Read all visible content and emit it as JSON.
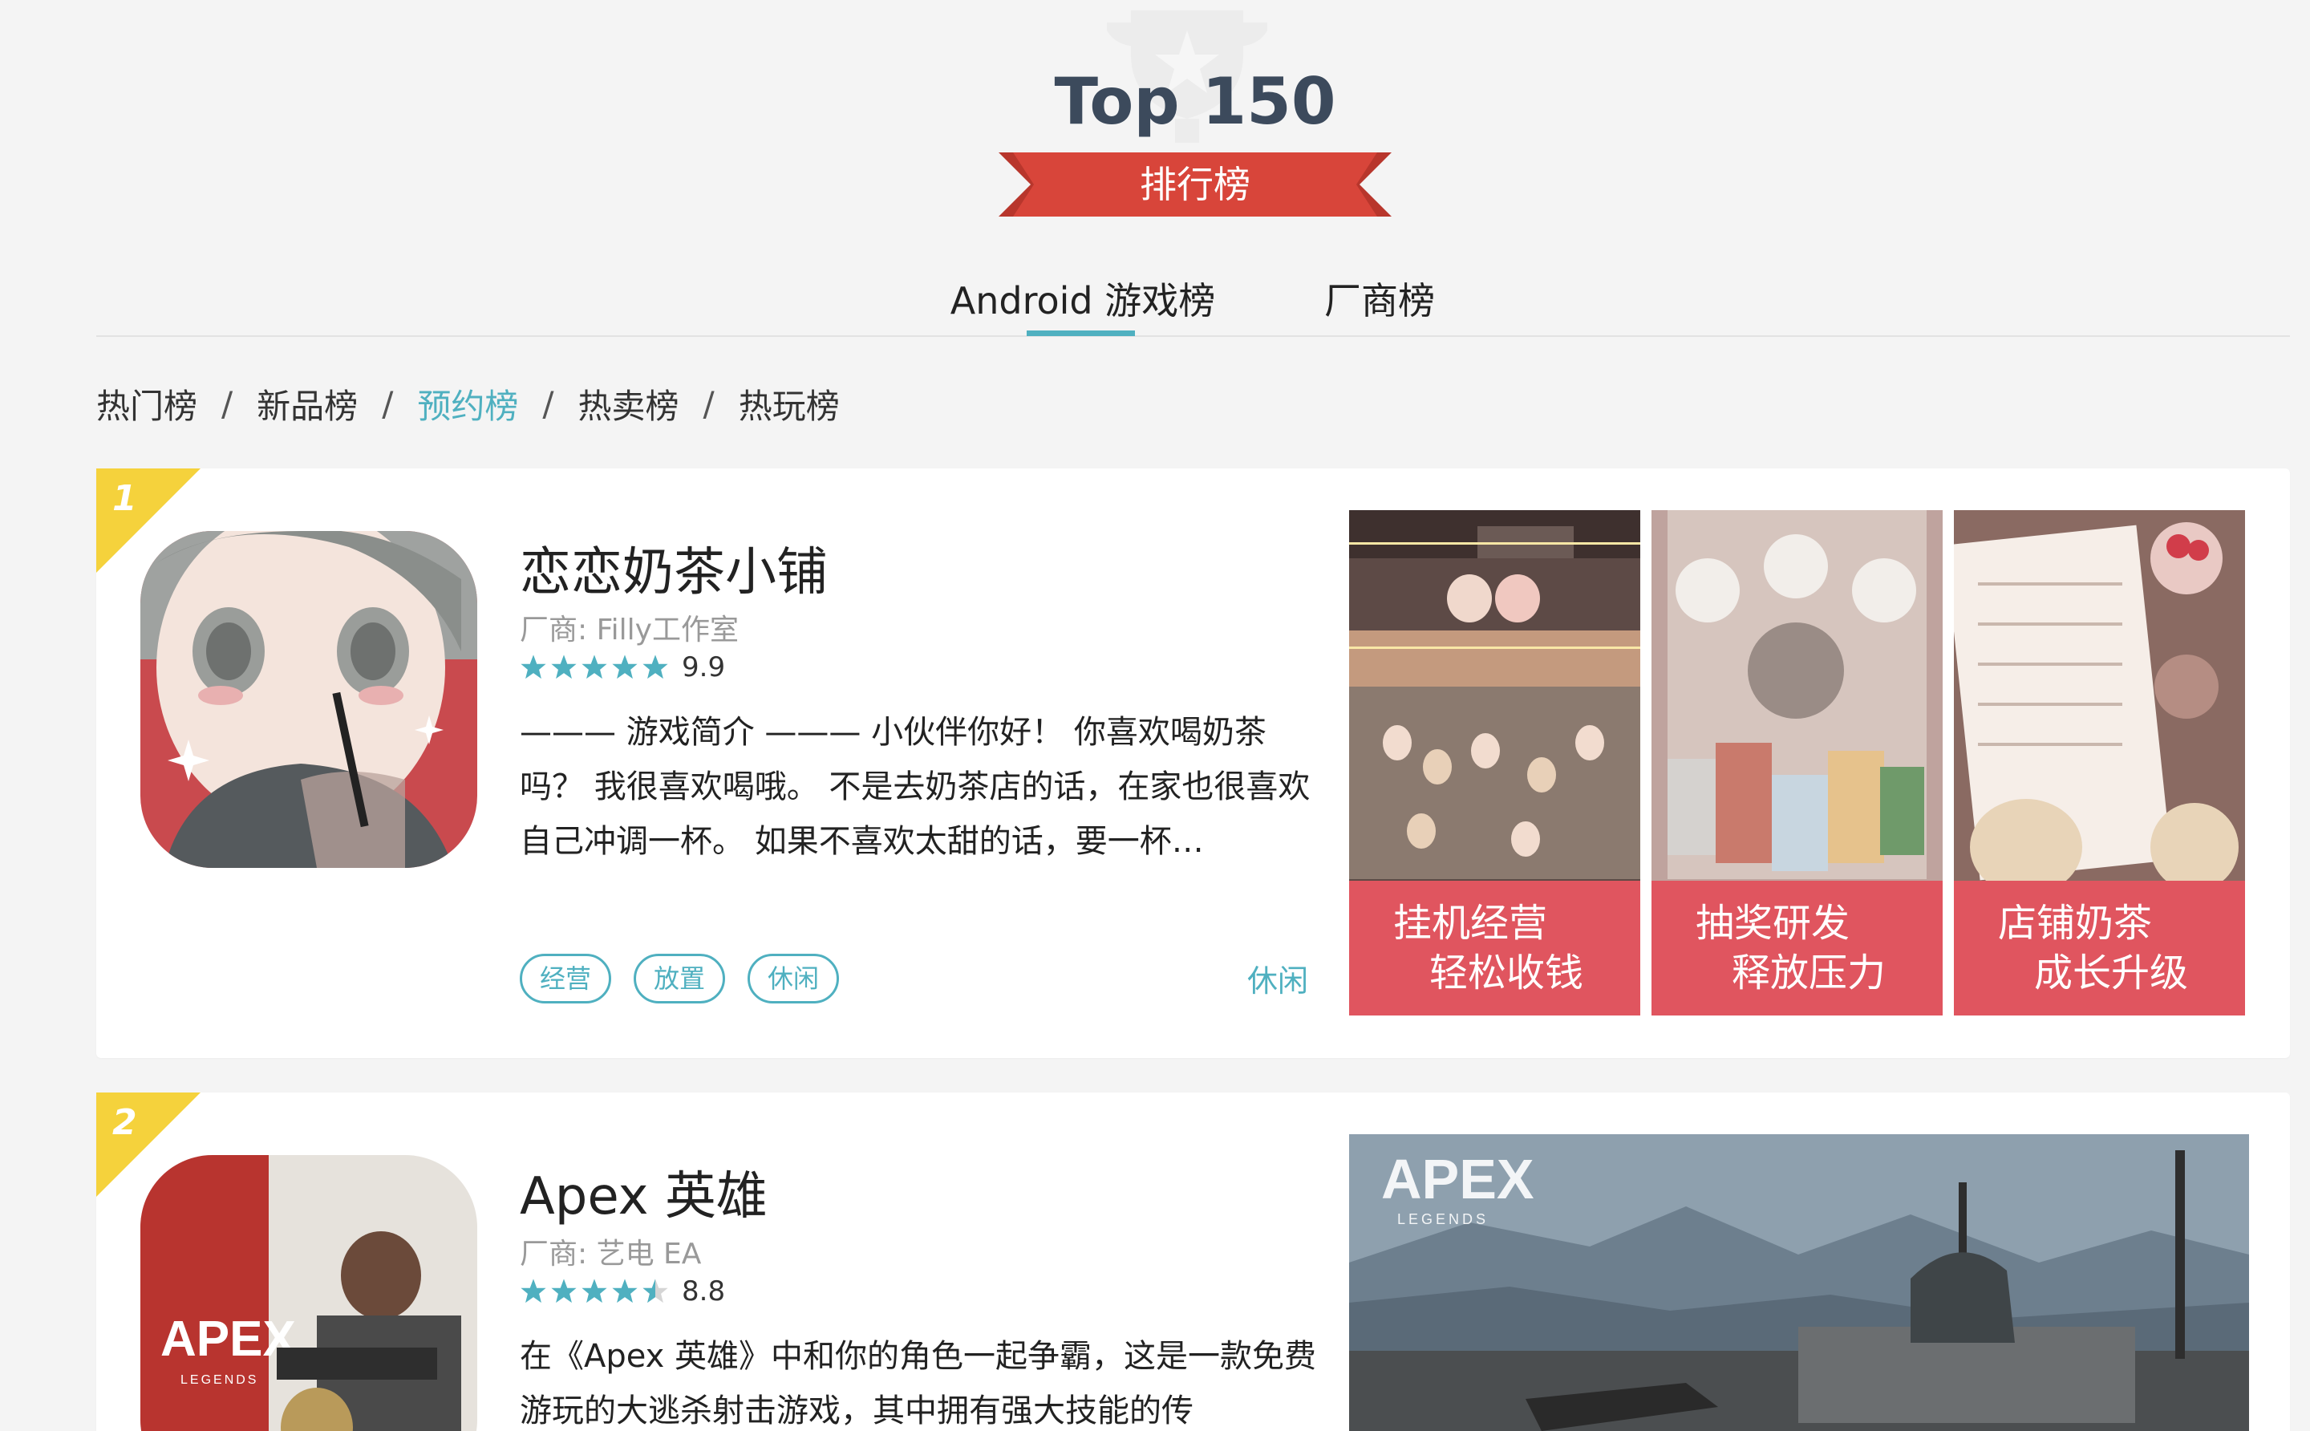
{
  "header": {
    "title": "Top 150",
    "ribbon_label": "排行榜"
  },
  "tabs": [
    {
      "label": "Android 游戏榜",
      "active": true
    },
    {
      "label": "厂商榜",
      "active": false
    }
  ],
  "subnav": [
    {
      "label": "热门榜",
      "active": false
    },
    {
      "label": "新品榜",
      "active": false
    },
    {
      "label": "预约榜",
      "active": true
    },
    {
      "label": "热卖榜",
      "active": false
    },
    {
      "label": "热玩榜",
      "active": false
    }
  ],
  "colors": {
    "accent": "#4fb0c0",
    "ribbon": "#d8453a",
    "rank_flag": "#f5d23c",
    "caption": "#e0555f"
  },
  "games": [
    {
      "rank": "1",
      "name": "恋恋奶茶小铺",
      "vendor": "厂商: Filly工作室",
      "rating_value": "9.9",
      "stars": 5,
      "description": "——— 游戏简介 ——— 小伙伴你好！ 你喜欢喝奶茶吗？ 我很喜欢喝哦。 不是去奶茶店的话，在家也很喜欢自己冲调一杯。 如果不喜欢太甜的话，要一杯…",
      "tags": [
        "经营",
        "放置",
        "休闲"
      ],
      "category": "休闲",
      "screenshots": [
        {
          "line1": "挂机经营",
          "line2": "轻松收钱"
        },
        {
          "line1": "抽奖研发",
          "line2": "释放压力"
        },
        {
          "line1": "店铺奶茶",
          "line2": "成长升级"
        }
      ]
    },
    {
      "rank": "2",
      "name": "Apex 英雄",
      "vendor": "厂商: 艺电 EA",
      "rating_value": "8.8",
      "stars": 4.5,
      "description": "在《Apex 英雄》中和你的角色一起争霸，这是一款免费游玩的大逃杀射击游戏，其中拥有强大技能的传",
      "icon_text": "APEX",
      "icon_subtext": "LEGENDS",
      "banner_text": "APEX",
      "banner_subtext": "LEGENDS"
    }
  ]
}
